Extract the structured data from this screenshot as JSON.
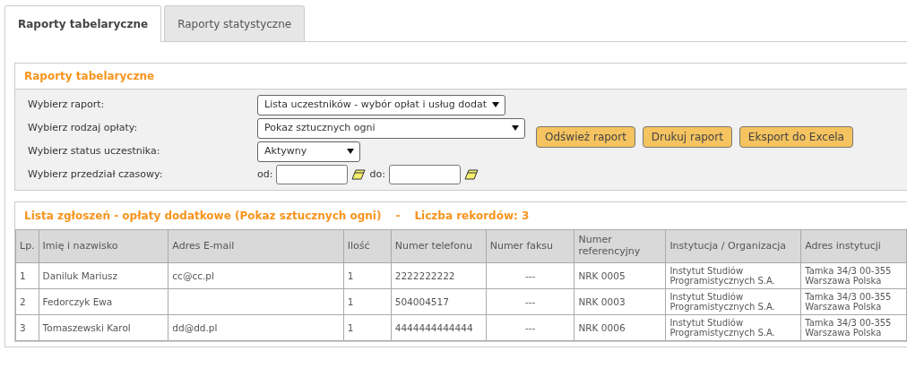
{
  "tabs": [
    {
      "label": "Raporty tabelaryczne",
      "selected": true
    },
    {
      "label": "Raporty statystyczne",
      "selected": false
    }
  ],
  "filter_panel": {
    "title": "Raporty tabelaryczne",
    "fields": [
      {
        "kind": "select",
        "label": "Wybierz raport:",
        "value": "Lista uczestników - wybór opłat i usług dodat"
      },
      {
        "kind": "select",
        "label": "Wybierz rodzaj opłaty:",
        "value": "Pokaz sztucznych ogni"
      },
      {
        "kind": "select",
        "label": "Wybierz status uczestnika:",
        "value": "Aktywny"
      },
      {
        "kind": "date_range",
        "label": "Wybierz przedział czasowy:",
        "from_label": "od:",
        "to_label": "do:"
      }
    ],
    "buttons": [
      "Odśwież raport",
      "Drukuj raport",
      "Eksport do Excela"
    ]
  },
  "results": {
    "title": "Lista zgłoszeń - opłaty dodatkowe (Pokaz sztucznych ogni)",
    "separator": "-",
    "count_label": "Liczba rekordów: 3",
    "columns": [
      "Lp.",
      "Imię i nazwisko",
      "Adres E-mail",
      "Ilość",
      "Numer telefonu",
      "Numer faksu",
      "Numer referencyjny",
      "Instytucja / Organizacja",
      "Adres instytucji"
    ],
    "rows": [
      [
        "1",
        "Daniluk Mariusz",
        "cc@cc.pl",
        "1",
        "2222222222",
        "---",
        "NRK 0005",
        "Instytut Studiów Programistycznych S.A.",
        "Tamka 34/3 00-355 Warszawa Polska"
      ],
      [
        "2",
        "Fedorczyk Ewa",
        "",
        "1",
        "504004517",
        "---",
        "NRK 0003",
        "Instytut Studiów Programistycznych S.A.",
        "Tamka 34/3 00-355 Warszawa Polska"
      ],
      [
        "3",
        "Tomaszewski Karol",
        "dd@dd.pl",
        "1",
        "4444444444444",
        "---",
        "NRK 0006",
        "Instytut Studiów Programistycznych S.A.",
        "Tamka 34/3 00-355 Warszawa Polska"
      ]
    ]
  }
}
